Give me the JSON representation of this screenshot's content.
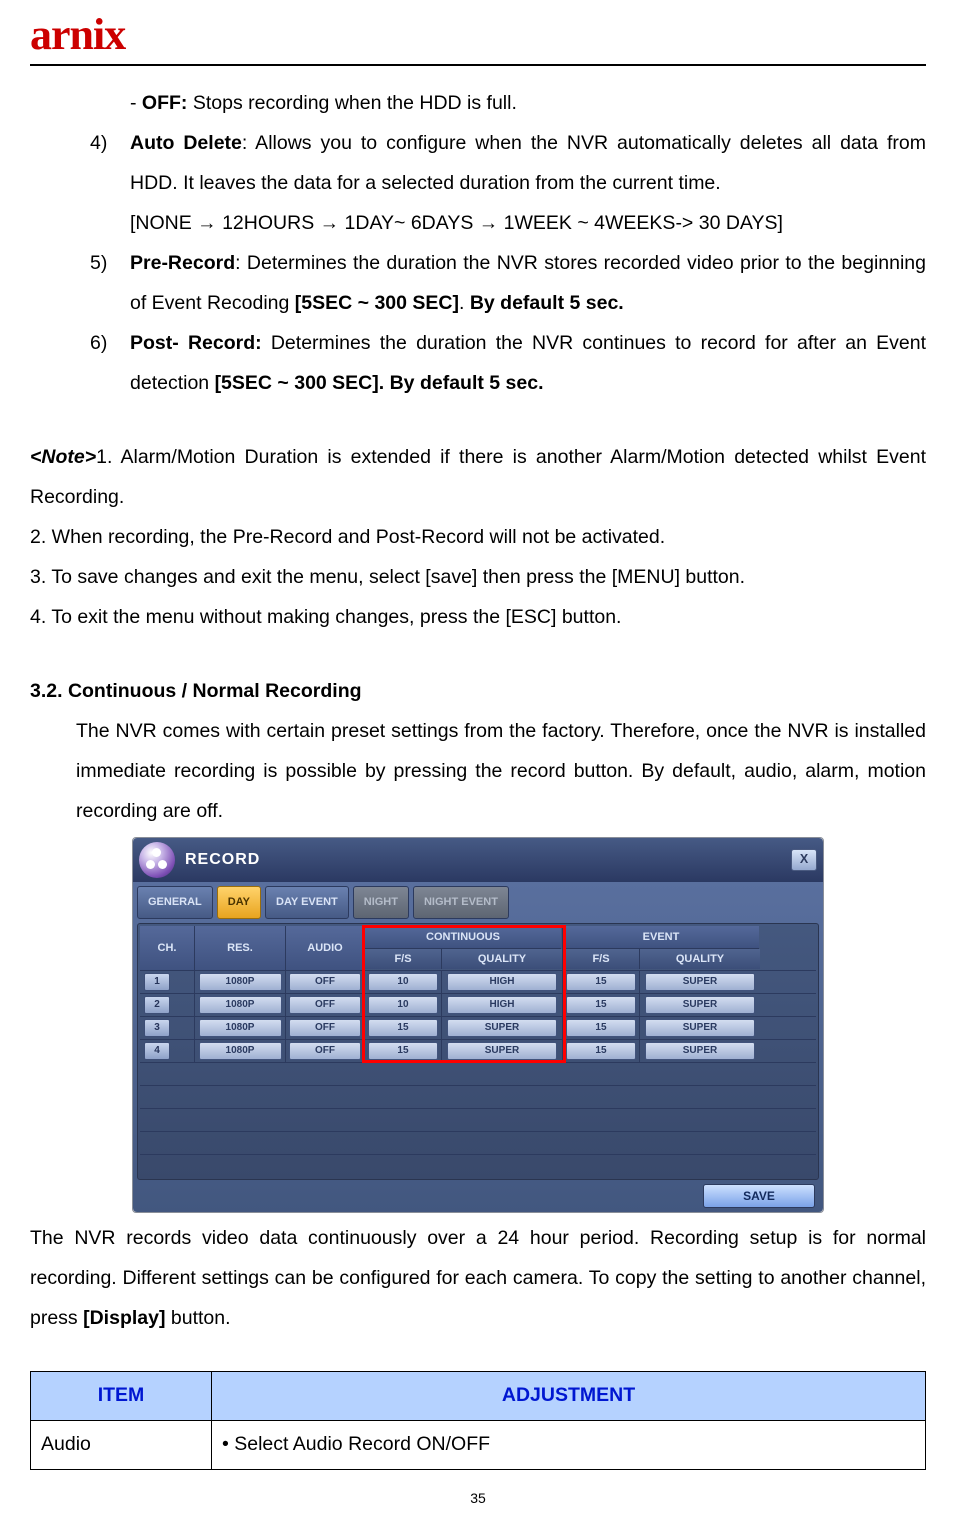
{
  "logo_text": "arnix",
  "off_line": {
    "prefix": "- ",
    "bold": "OFF:",
    "rest": " Stops recording when the HDD is full."
  },
  "items": [
    {
      "num": "4)",
      "bold": "Auto Delete",
      "rest1": ": Allows you to configure when the NVR automatically deletes all data from HDD. It leaves the data for a selected duration from the current time.",
      "line2": "[NONE → 12HOURS → 1DAY~ 6DAYS → 1WEEK ~ 4WEEKS-> 30 DAYS]"
    },
    {
      "num": "5)",
      "bold": "Pre-Record",
      "rest1": ": Determines the duration the NVR stores recorded video prior to the beginning of Event Recoding ",
      "bold2": "[5SEC ~ 300 SEC]",
      "rest2": ". ",
      "bold3": "By default 5 sec."
    },
    {
      "num": "6)",
      "bold": "Post- Record:",
      "rest1": " Determines the duration the NVR continues to record for after an Event detection ",
      "bold2": "[5SEC ~ 300 SEC]. By default 5 sec."
    }
  ],
  "note_label": "<Note>",
  "notes": [
    "1. Alarm/Motion Duration is extended if there is another Alarm/Motion detected whilst Event Recording.",
    "2. When recording, the Pre-Record and Post-Record will not be activated.",
    "3. To save changes and exit the menu, select [save] then press the [MENU] button.",
    "4. To exit the menu without making changes, press the [ESC] button."
  ],
  "section_heading": "3.2.  Continuous  /  Normal  Recording",
  "section_body": "The NVR comes with certain preset settings from the factory. Therefore, once the NVR is installed immediate recording is possible by pressing the record button. By default, audio, alarm, motion recording are off.",
  "shot": {
    "title": "RECORD",
    "close": "X",
    "tabs": [
      "GENERAL",
      "DAY",
      "DAY EVENT",
      "NIGHT",
      "NIGHT EVENT"
    ],
    "active_tab_index": 1,
    "disabled_tab_indices": [
      3,
      4
    ],
    "headers": {
      "ch": "CH.",
      "res": "RES.",
      "audio": "AUDIO",
      "cont": "CONTINUOUS",
      "event": "EVENT",
      "fs": "F/S",
      "quality": "QUALITY"
    },
    "rows": [
      {
        "ch": "1",
        "res": "1080P",
        "audio": "OFF",
        "c_fs": "10",
        "c_q": "HIGH",
        "e_fs": "15",
        "e_q": "SUPER"
      },
      {
        "ch": "2",
        "res": "1080P",
        "audio": "OFF",
        "c_fs": "10",
        "c_q": "HIGH",
        "e_fs": "15",
        "e_q": "SUPER"
      },
      {
        "ch": "3",
        "res": "1080P",
        "audio": "OFF",
        "c_fs": "15",
        "c_q": "SUPER",
        "e_fs": "15",
        "e_q": "SUPER"
      },
      {
        "ch": "4",
        "res": "1080P",
        "audio": "OFF",
        "c_fs": "15",
        "c_q": "SUPER",
        "e_fs": "15",
        "e_q": "SUPER"
      }
    ],
    "save": "SAVE"
  },
  "after_shot": {
    "t1": "The NVR records video data continuously over a 24 hour period. Recording setup is for normal recording. Different settings can be configured for each camera. To copy the setting to another channel, press ",
    "bold": "[Display]",
    "t2": " button."
  },
  "table": {
    "head_item": "ITEM",
    "head_adj": "ADJUSTMENT",
    "row_item": "Audio",
    "row_adj": "• Select Audio Record ON/OFF"
  },
  "page_num": "35"
}
